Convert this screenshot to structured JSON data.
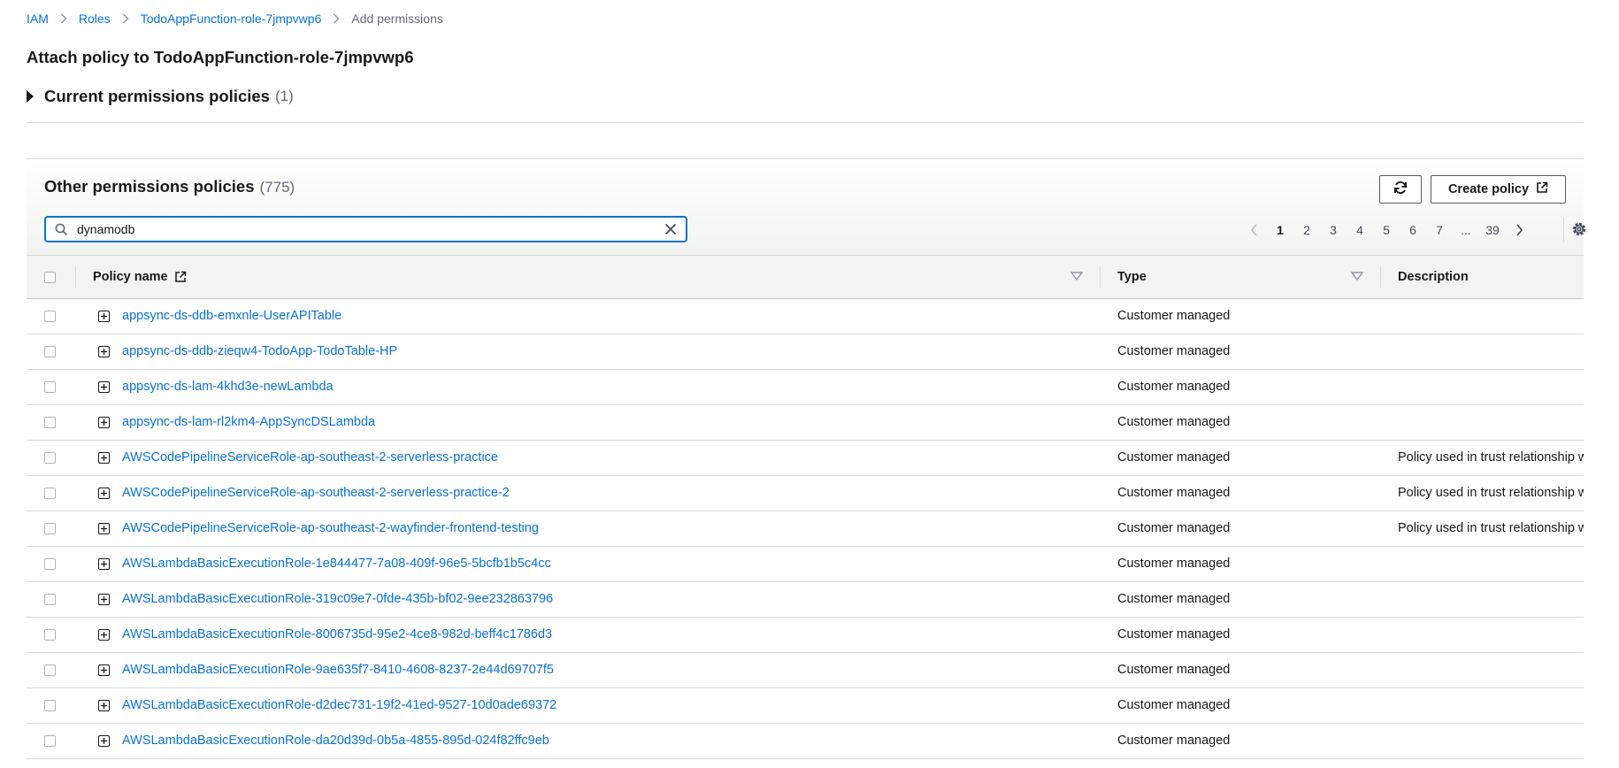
{
  "breadcrumb": {
    "items": [
      "IAM",
      "Roles",
      "TodoAppFunction-role-7jmpvwp6"
    ],
    "current": "Add permissions"
  },
  "page_title": "Attach policy to TodoAppFunction-role-7jmpvwp6",
  "current_policies": {
    "label": "Current permissions policies",
    "count": "(1)"
  },
  "other_policies": {
    "title": "Other permissions policies",
    "count": "(775)",
    "create_label": "Create policy",
    "search": {
      "value": "dynamodb",
      "placeholder": ""
    }
  },
  "pagination": {
    "pages": [
      "1",
      "2",
      "3",
      "4",
      "5",
      "6",
      "7",
      "...",
      "39"
    ],
    "current": "1"
  },
  "table": {
    "headers": {
      "policy_name": "Policy name",
      "type": "Type",
      "description": "Description"
    },
    "rows": [
      {
        "name": "appsync-ds-ddb-emxnle-UserAPITable",
        "type": "Customer managed",
        "description": ""
      },
      {
        "name": "appsync-ds-ddb-zieqw4-TodoApp-TodoTable-HP",
        "type": "Customer managed",
        "description": ""
      },
      {
        "name": "appsync-ds-lam-4khd3e-newLambda",
        "type": "Customer managed",
        "description": ""
      },
      {
        "name": "appsync-ds-lam-rl2km4-AppSyncDSLambda",
        "type": "Customer managed",
        "description": ""
      },
      {
        "name": "AWSCodePipelineServiceRole-ap-southeast-2-serverless-practice",
        "type": "Customer managed",
        "description": "Policy used in trust relationship w"
      },
      {
        "name": "AWSCodePipelineServiceRole-ap-southeast-2-serverless-practice-2",
        "type": "Customer managed",
        "description": "Policy used in trust relationship w"
      },
      {
        "name": "AWSCodePipelineServiceRole-ap-southeast-2-wayfinder-frontend-testing",
        "type": "Customer managed",
        "description": "Policy used in trust relationship w"
      },
      {
        "name": "AWSLambdaBasicExecutionRole-1e844477-7a08-409f-96e5-5bcfb1b5c4cc",
        "type": "Customer managed",
        "description": ""
      },
      {
        "name": "AWSLambdaBasicExecutionRole-319c09e7-0fde-435b-bf02-9ee232863796",
        "type": "Customer managed",
        "description": ""
      },
      {
        "name": "AWSLambdaBasicExecutionRole-8006735d-95e2-4ce8-982d-beff4c1786d3",
        "type": "Customer managed",
        "description": ""
      },
      {
        "name": "AWSLambdaBasicExecutionRole-9ae635f7-8410-4608-8237-2e44d69707f5",
        "type": "Customer managed",
        "description": ""
      },
      {
        "name": "AWSLambdaBasicExecutionRole-d2dec731-19f2-41ed-9527-10d0ade69372",
        "type": "Customer managed",
        "description": ""
      },
      {
        "name": "AWSLambdaBasicExecutionRole-da20d39d-0b5a-4855-895d-024f82ffc9eb",
        "type": "Customer managed",
        "description": ""
      }
    ]
  },
  "icons": {
    "refresh": "refresh-icon",
    "external": "external-link-icon",
    "search": "search-icon",
    "clear": "close-icon",
    "settings": "gear-icon",
    "expand": "plus-square-icon"
  },
  "colors": {
    "link": "#0972d3",
    "focus": "#0972d3",
    "text": "#16191f",
    "muted": "#5f6b7a"
  }
}
